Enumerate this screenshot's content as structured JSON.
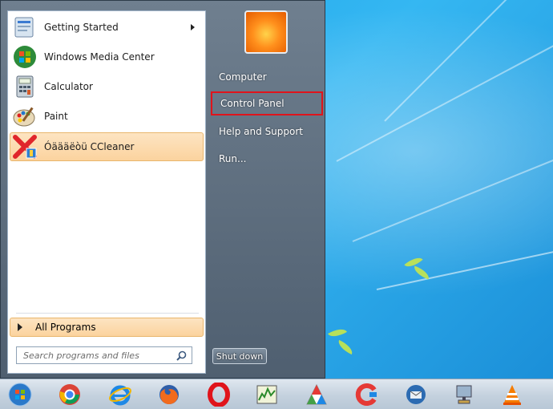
{
  "start_menu": {
    "pinned_programs": [
      {
        "label": "Getting Started",
        "icon": "getting-started-icon",
        "has_submenu": true
      },
      {
        "label": "Windows Media Center",
        "icon": "windows-media-center-icon",
        "has_submenu": false
      },
      {
        "label": "Calculator",
        "icon": "calculator-icon",
        "has_submenu": false
      },
      {
        "label": "Paint",
        "icon": "paint-icon",
        "has_submenu": false
      },
      {
        "label": "Óäääëòü CCleaner",
        "icon": "ccleaner-icon",
        "has_submenu": false,
        "highlighted": true
      }
    ],
    "all_programs_label": "All Programs",
    "search": {
      "placeholder": "Search programs and files"
    },
    "right_items": [
      {
        "label": "Computer"
      },
      {
        "label": "Control Panel",
        "outlined": true
      },
      {
        "label": "Help and Support"
      },
      {
        "label": "Run..."
      }
    ],
    "shutdown_label": "Shut down"
  },
  "taskbar": {
    "items": [
      "start-orb-icon",
      "chrome-icon",
      "internet-explorer-icon",
      "firefox-icon",
      "opera-icon",
      "task-manager-icon",
      "origin-icon",
      "ccleaner-icon",
      "thunderbird-icon",
      "network-icon",
      "vlc-icon"
    ]
  },
  "colors": {
    "highlight": "#fbd39e",
    "outline": "#e0141b",
    "desktop": "#1aa3e8"
  }
}
